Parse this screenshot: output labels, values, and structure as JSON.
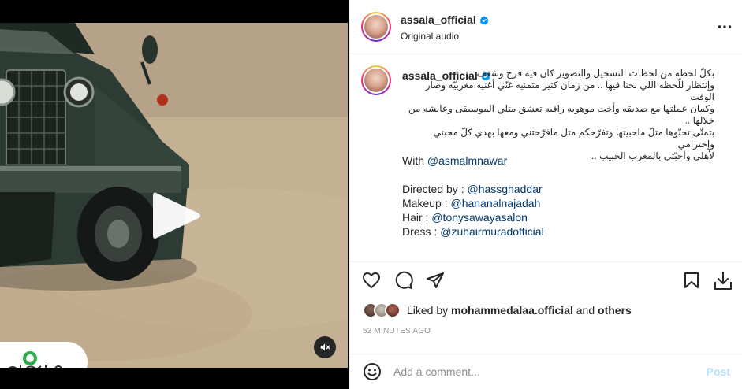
{
  "post": {
    "username": "assala_official",
    "audio": "Original audio"
  },
  "caption": {
    "username": "assala_official",
    "arabic_lines": [
      "بكلّ لحظه من لحظات التسجيل والتصوير كان فيه فرح وشغف",
      "وإنتظار للّحظه اللي نحنا فيها .. من زمان كتير متمنيه غنّي أغنيه مغربيّه وصار الوقت",
      "وكمان عملتها مع صديقه وأخت موهوبه راقيه تعشق متلي الموسيقى وعايشه من خلالها ..",
      "بتمنّى تحبّوها متلّ ماحبيتها وتفرّحكم متل مافرّحتني ومعها بهدي كلّ محبتي وإحترامي",
      "لأهلي وأحبّتي بالمغرب الحبيب .."
    ],
    "with_label": "With ",
    "with_mention": "@asmalmnawar",
    "credits": [
      {
        "label": "Directed by : ",
        "mention": "@hassghaddar"
      },
      {
        "label": "Makeup : ",
        "mention": "@hananalnajadah"
      },
      {
        "label": "Hair : ",
        "mention": "@tonysawayasalon"
      },
      {
        "label": "Dress : ",
        "mention": "@zuhairmuradofficial"
      }
    ]
  },
  "likes": {
    "prefix": "Liked by ",
    "user": "mohammedalaa.official",
    "middle": " and ",
    "others": "others"
  },
  "timestamp": "52 MINUTES AGO",
  "comment": {
    "placeholder": "Add a comment...",
    "post_label": "Post"
  },
  "icons": {
    "more": "more-horizontal-icon",
    "verified": "verified-badge-icon",
    "like": "heart-icon",
    "comment": "comment-icon",
    "share": "paper-plane-icon",
    "save": "bookmark-icon",
    "download": "download-icon",
    "emoji": "emoji-icon",
    "play": "play-icon",
    "mute": "speaker-muted-icon"
  },
  "colors": {
    "link": "#00376b",
    "muted": "#8e8e8e",
    "verified": "#0095f6",
    "post_disabled": "#b2dffc"
  }
}
